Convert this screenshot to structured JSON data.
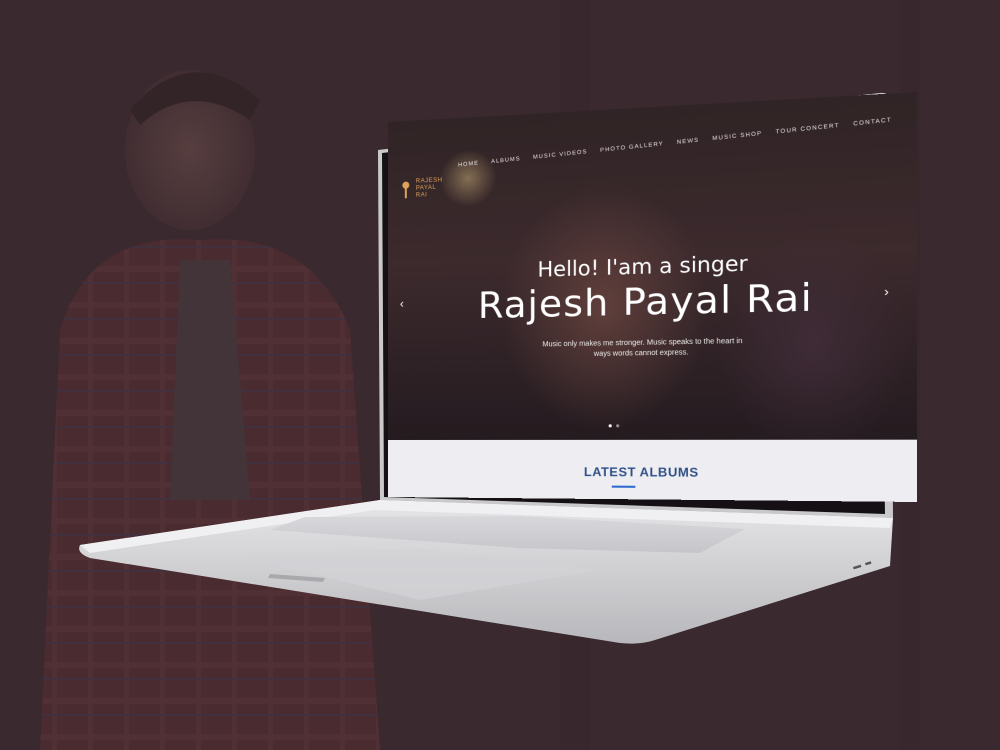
{
  "site": {
    "logo_text": "RAJESH PAYAL RAI",
    "nav": [
      "HOME",
      "ALBUMS",
      "MUSIC VIDEOS",
      "PHOTO GALLERY",
      "NEWS",
      "MUSIC SHOP",
      "TOUR CONCERT",
      "CONTACT"
    ],
    "hero": {
      "greeting": "Hello! I'am a singer",
      "name": "Rajesh Payal Rai",
      "tagline": "Music only makes me stronger. Music speaks to the heart in ways words cannot express.",
      "prev_icon": "chevron-left-icon",
      "next_icon": "chevron-right-icon",
      "slides_total": 2,
      "slide_active": 1
    },
    "section_title": "LATEST ALBUMS"
  },
  "colors": {
    "background": "#3a2a2f",
    "accent_blue": "#2e4f86",
    "logo_gold": "#e0a35a"
  }
}
